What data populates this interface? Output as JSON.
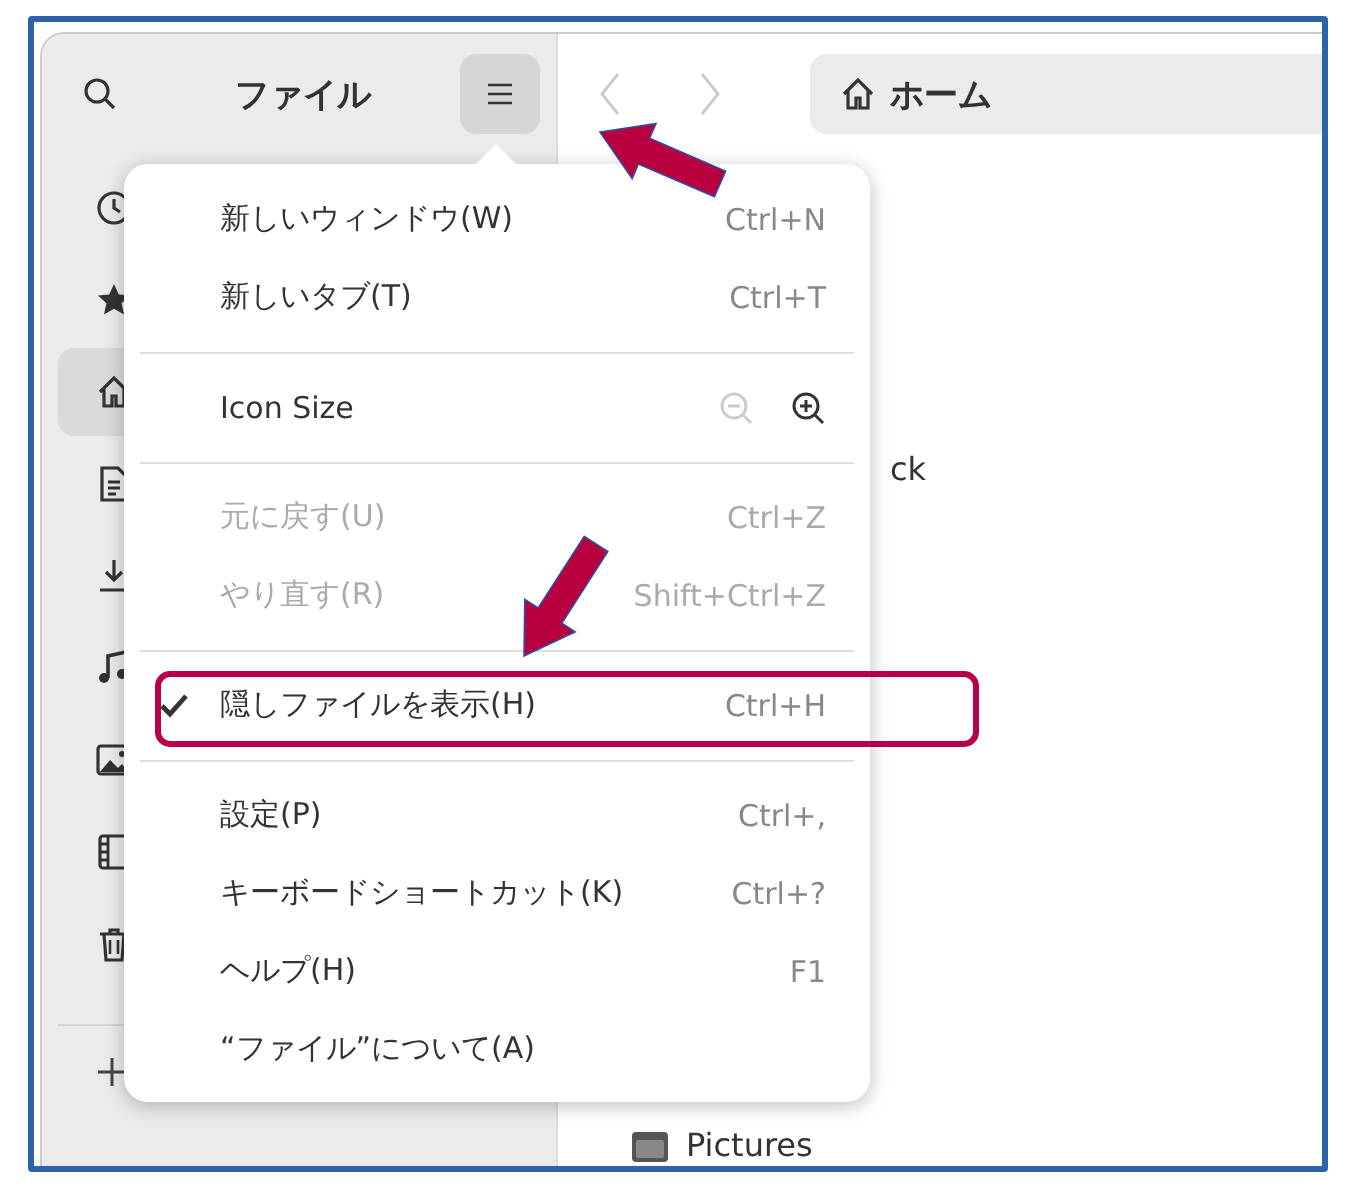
{
  "sidebar": {
    "title": "ファイル",
    "menu_button": {
      "selected": true
    },
    "items": [
      {
        "kind": "history",
        "selected": false
      },
      {
        "kind": "starred",
        "selected": false
      },
      {
        "kind": "home",
        "selected": true
      },
      {
        "kind": "documents",
        "selected": false
      },
      {
        "kind": "downloads",
        "selected": false
      },
      {
        "kind": "music",
        "selected": false
      },
      {
        "kind": "pictures",
        "selected": false
      },
      {
        "kind": "videos",
        "selected": false
      },
      {
        "kind": "trash",
        "selected": false
      }
    ]
  },
  "navigation": {
    "back": {
      "disabled": true
    },
    "forward": {
      "disabled": true
    }
  },
  "path_bar": {
    "label": "ホーム"
  },
  "content": {
    "partial_text": "ck",
    "items": [
      {
        "label": "Pictures"
      }
    ]
  },
  "menu": {
    "sections": [
      [
        {
          "kind": "command",
          "label": "新しいウィンドウ(W)",
          "shortcut": "Ctrl+N",
          "disabled": false,
          "checked": false
        },
        {
          "kind": "command",
          "label": "新しいタブ(T)",
          "shortcut": "Ctrl+T",
          "disabled": false,
          "checked": false
        }
      ],
      [
        {
          "kind": "zoom",
          "label": "Icon Size",
          "zoom_out_disabled": true,
          "zoom_in_disabled": false
        }
      ],
      [
        {
          "kind": "command",
          "label": "元に戻す(U)",
          "shortcut": "Ctrl+Z",
          "disabled": true,
          "checked": false
        },
        {
          "kind": "command",
          "label": "やり直す(R)",
          "shortcut": "Shift+Ctrl+Z",
          "disabled": true,
          "checked": false
        }
      ],
      [
        {
          "kind": "command",
          "label": "隠しファイルを表示(H)",
          "shortcut": "Ctrl+H",
          "disabled": false,
          "checked": true
        }
      ],
      [
        {
          "kind": "command",
          "label": "設定(P)",
          "shortcut": "Ctrl+,",
          "disabled": false,
          "checked": false
        },
        {
          "kind": "command",
          "label": "キーボードショートカット(K)",
          "shortcut": "Ctrl+?",
          "disabled": false,
          "checked": false
        },
        {
          "kind": "command",
          "label": "ヘルプ(H)",
          "shortcut": "F1",
          "disabled": false,
          "checked": false
        },
        {
          "kind": "command",
          "label": "“ファイル”について(A)",
          "disabled": false,
          "checked": false
        }
      ]
    ]
  },
  "annotations": [
    {
      "kind": "arrow"
    },
    {
      "kind": "arrow"
    },
    {
      "kind": "frame"
    }
  ]
}
